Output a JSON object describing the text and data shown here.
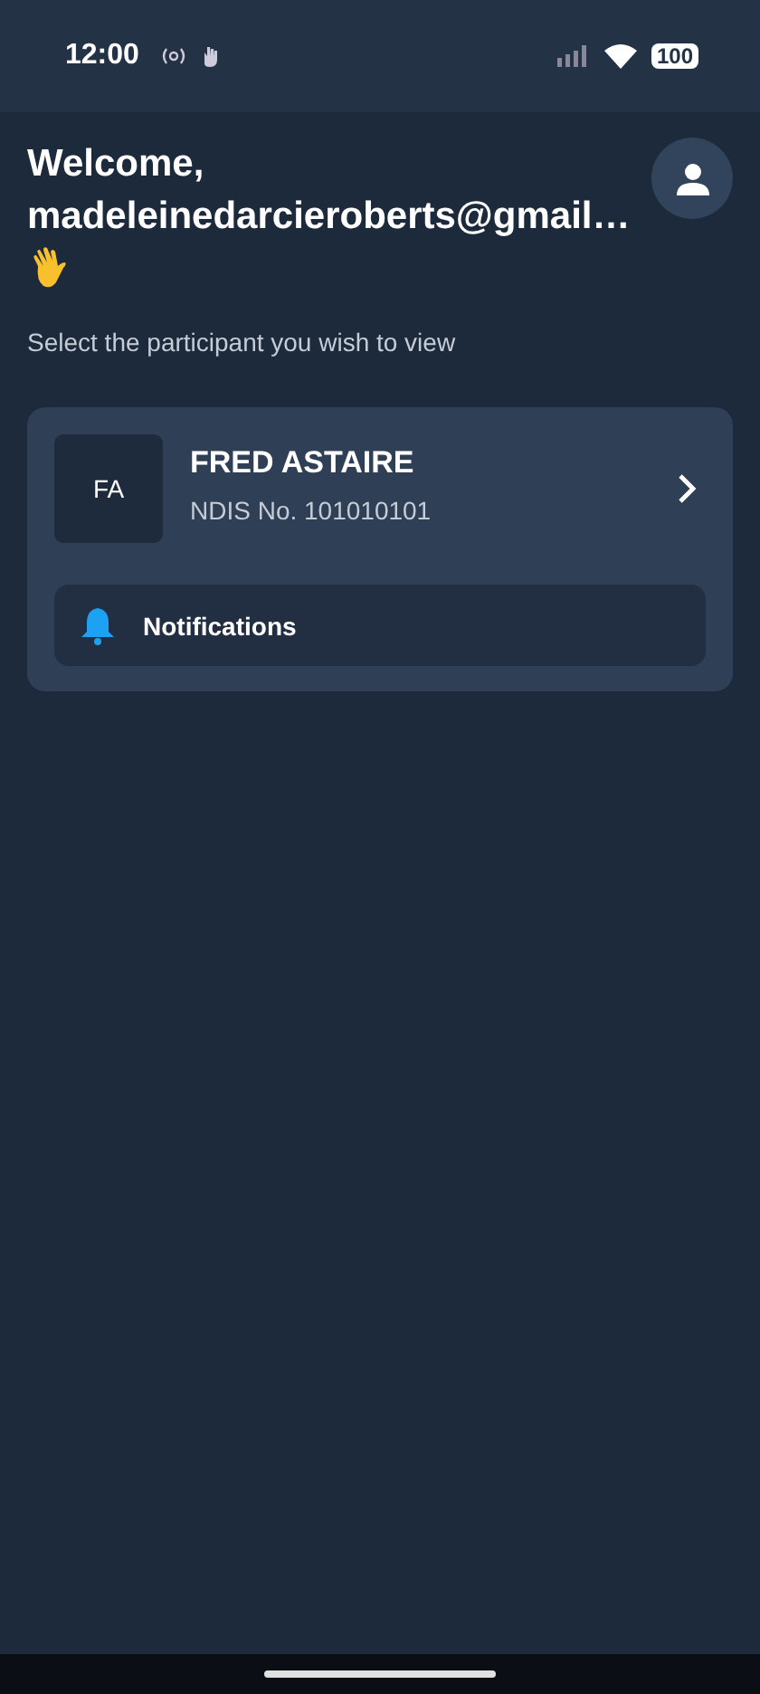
{
  "status_bar": {
    "time": "12:00",
    "battery": "100"
  },
  "header": {
    "greeting": "Welcome,",
    "email": "madeleinedarcieroberts@gmail…",
    "subtitle": "Select the participant you wish to view"
  },
  "participants": [
    {
      "initials": "FA",
      "name": "FRED ASTAIRE",
      "ndis": "NDIS No. 101010101",
      "notifications": "Notifications"
    }
  ]
}
